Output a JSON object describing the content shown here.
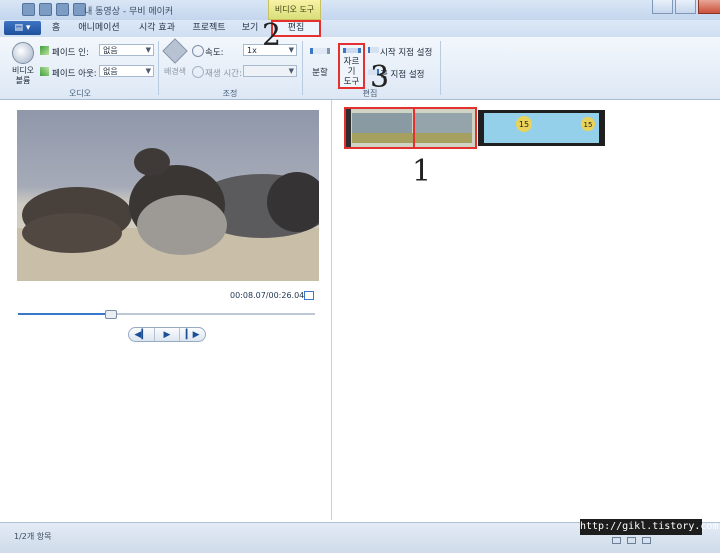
{
  "window": {
    "title": "내 동영상 - 무비 메이커"
  },
  "ribbon": {
    "context_group_label": "비디오 도구",
    "app_menu_label": "▤ ▾",
    "tabs": [
      {
        "label": "홈"
      },
      {
        "label": "애니메이션"
      },
      {
        "label": "시각 효과"
      },
      {
        "label": "프로젝트"
      },
      {
        "label": "보기"
      },
      {
        "label": "편집"
      }
    ],
    "audio": {
      "volume_label": "비디오 볼륨",
      "fade_in_label": "페이드 인:",
      "fade_in_value": "없음",
      "fade_out_label": "페이드 아웃:",
      "fade_out_value": "없음",
      "group_label": "오디오"
    },
    "adjust": {
      "background_color_label": "배경색",
      "speed_label": "속도:",
      "speed_value": "1x",
      "duration_label": "재생 시간:",
      "duration_value": "",
      "group_label": "조정"
    },
    "edit": {
      "split_label": "분할",
      "trim_label_line1": "자르기",
      "trim_label_line2": "도구",
      "set_start_label": "시작 지점 설정",
      "set_end_label": "끝 지점 설정",
      "group_label": "편집"
    }
  },
  "preview": {
    "timecode": "00:08.07/00:26.04",
    "seek_progress": 0.31
  },
  "storyboard": {
    "clip2_badge": "15"
  },
  "annotations": {
    "one": "1",
    "two": "2",
    "three": "3"
  },
  "status": {
    "items_text": "1/2개 항목",
    "watermark": "http://gikl.tistory.com"
  },
  "colors": {
    "highlight": "#e53030",
    "accent": "#3a78c9"
  }
}
